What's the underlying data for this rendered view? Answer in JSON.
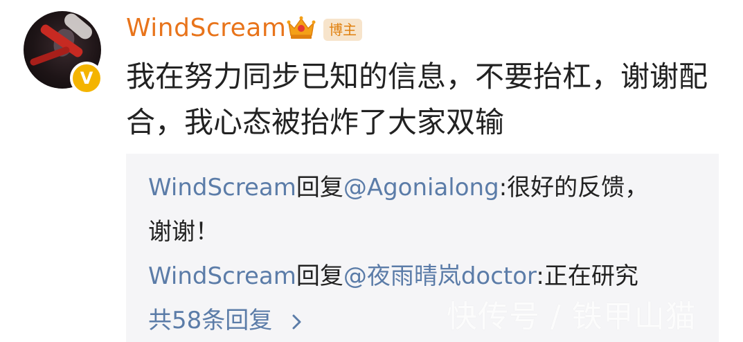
{
  "post": {
    "username": "WindScream",
    "badge_label": "博主",
    "verified_symbol": "V",
    "text": "我在努力同步已知的信息，不要抬杠，谢谢配合，我心态被抬炸了大家双输"
  },
  "replies": [
    {
      "author": "WindScream",
      "verb": "回复",
      "target": "@Agonialong",
      "sep": ":",
      "text_line1": "很好的反馈，",
      "text_line2": "谢谢！"
    },
    {
      "author": "WindScream",
      "verb": "回复",
      "target": "@夜雨晴岚doctor",
      "sep": ":",
      "text_line1": "正在研究"
    }
  ],
  "more_replies": {
    "label": "共58条回复",
    "icon": "chevron-right-icon"
  },
  "watermark": "快传号 / 铁甲山猫",
  "colors": {
    "username": "#e8741b",
    "link": "#5b7ca8",
    "badge_bg": "#f7e4cb",
    "verified": "#f4b400"
  }
}
